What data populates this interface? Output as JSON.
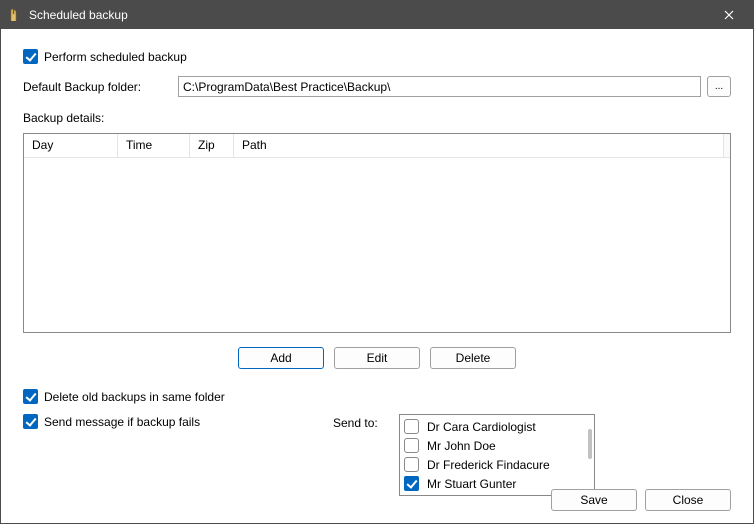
{
  "window": {
    "title": "Scheduled backup",
    "close_tooltip": "Close"
  },
  "perform_backup": {
    "label": "Perform scheduled backup",
    "checked": true
  },
  "folder": {
    "label": "Default Backup folder:",
    "value": "C:\\ProgramData\\Best Practice\\Backup\\",
    "browse_label": "..."
  },
  "details": {
    "label": "Backup details:"
  },
  "grid": {
    "columns": {
      "day": "Day",
      "time": "Time",
      "zip": "Zip",
      "path": "Path"
    }
  },
  "buttons": {
    "add": "Add",
    "edit": "Edit",
    "delete": "Delete",
    "save": "Save",
    "close": "Close"
  },
  "options": {
    "delete_old": {
      "label": "Delete old backups in same folder",
      "checked": true
    },
    "send_msg": {
      "label": "Send message if backup fails",
      "checked": true
    }
  },
  "send_to": {
    "label": "Send to:",
    "recipients": [
      {
        "name": "Dr Cara Cardiologist",
        "checked": false
      },
      {
        "name": "Mr John Doe",
        "checked": false
      },
      {
        "name": "Dr Frederick Findacure",
        "checked": false
      },
      {
        "name": "Mr Stuart Gunter",
        "checked": true
      }
    ]
  }
}
